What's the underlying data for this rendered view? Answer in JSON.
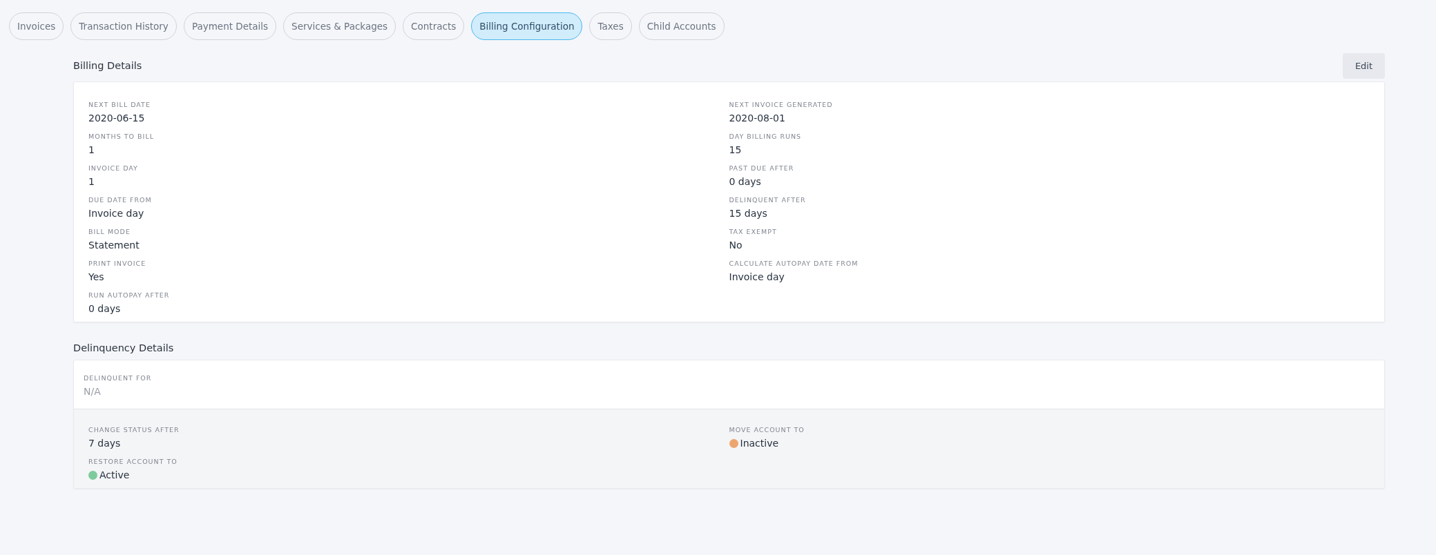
{
  "tabs": [
    {
      "label": "Invoices",
      "selected": false
    },
    {
      "label": "Transaction History",
      "selected": false
    },
    {
      "label": "Payment Details",
      "selected": false
    },
    {
      "label": "Services & Packages",
      "selected": false
    },
    {
      "label": "Contracts",
      "selected": false
    },
    {
      "label": "Billing Configuration",
      "selected": true
    },
    {
      "label": "Taxes",
      "selected": false
    },
    {
      "label": "Child Accounts",
      "selected": false
    }
  ],
  "billing_details": {
    "title": "Billing Details",
    "edit_button": "Edit",
    "left_fields": [
      {
        "label": "NEXT BILL DATE",
        "value": "2020-06-15"
      },
      {
        "label": "MONTHS TO BILL",
        "value": "1"
      },
      {
        "label": "INVOICE DAY",
        "value": "1"
      },
      {
        "label": "DUE DATE FROM",
        "value": "Invoice day"
      },
      {
        "label": "BILL MODE",
        "value": "Statement"
      },
      {
        "label": "PRINT INVOICE",
        "value": "Yes"
      },
      {
        "label": "RUN AUTOPAY AFTER",
        "value": "0 days"
      }
    ],
    "right_fields": [
      {
        "label": "NEXT INVOICE GENERATED",
        "value": "2020-08-01"
      },
      {
        "label": "DAY BILLING RUNS",
        "value": "15"
      },
      {
        "label": "PAST DUE AFTER",
        "value": "0 days"
      },
      {
        "label": "DELINQUENT AFTER",
        "value": "15 days"
      },
      {
        "label": "TAX EXEMPT",
        "value": "No"
      },
      {
        "label": "CALCULATE AUTOPAY DATE FROM",
        "value": "Invoice day"
      }
    ]
  },
  "delinquency_details": {
    "title": "Delinquency Details",
    "delinquent_for": {
      "label": "DELINQUENT FOR",
      "value": "N/A",
      "disabled": true
    },
    "left_fields": [
      {
        "label": "CHANGE STATUS AFTER",
        "value": "7 days"
      },
      {
        "label": "RESTORE ACCOUNT TO",
        "value": "Active",
        "color": "#7dcb9c"
      }
    ],
    "right_fields": [
      {
        "label": "MOVE ACCOUNT TO",
        "value": "Inactive",
        "color": "#eda56e"
      }
    ]
  }
}
